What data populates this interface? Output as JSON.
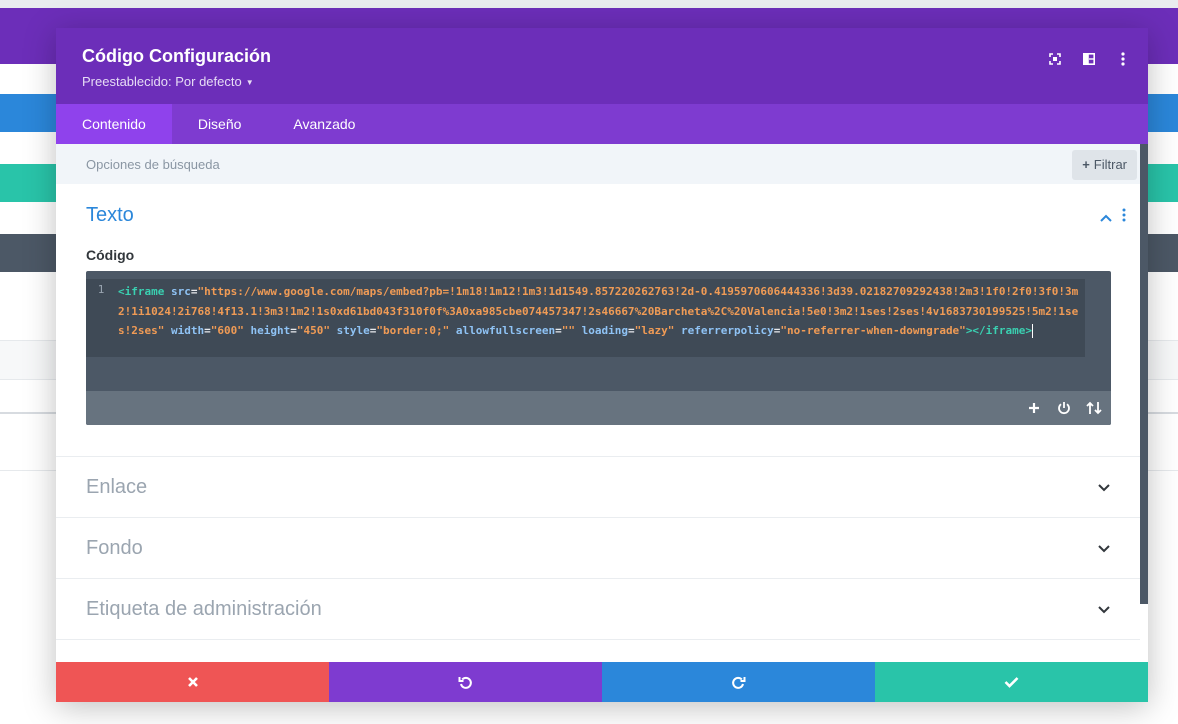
{
  "header": {
    "title": "Código Configuración",
    "preset_label": "Preestablecido: Por defecto"
  },
  "tabs": [
    {
      "label": "Contenido",
      "active": true
    },
    {
      "label": "Diseño",
      "active": false
    },
    {
      "label": "Avanzado",
      "active": false
    }
  ],
  "search": {
    "placeholder": "Opciones de búsqueda",
    "filter_label": "Filtrar"
  },
  "sections": {
    "texto": {
      "title": "Texto",
      "field_label": "Código",
      "editor": {
        "line_number": "1",
        "tokens": {
          "t1": "<iframe",
          "a1": " src",
          "e1": "=",
          "s1": "\"https://www.google.com/maps/embed?pb=!1m18!1m12!1m3!1d1549.857220262763!2d-0.4195970606444336!3d39.02182709292438!2m3!1f0!2f0!3f0!3m2!1i1024!2i768!4f13.1!3m3!1m2!1s0xd61bd043f310f0f%3A0xa985cbe074457347!2s46667%20Barcheta%2C%20Valencia!5e0!3m2!1ses!2ses!4v1683730199525!5m2!1ses!2ses\"",
          "a2": " width",
          "e2": "=",
          "s2": "\"600\"",
          "a3": " height",
          "e3": "=",
          "s3": "\"450\"",
          "a4": " style",
          "e4": "=",
          "s4": "\"border:0;\"",
          "a5": " allowfullscreen",
          "e5": "=",
          "s5": "\"\"",
          "a6": " loading",
          "e6": "=",
          "s6": "\"lazy\"",
          "a7": " referrerpolicy",
          "e7": "=",
          "s7": "\"no-referrer-when-downgrade\"",
          "t2": "></iframe>"
        }
      }
    },
    "enlace": {
      "title": "Enlace"
    },
    "fondo": {
      "title": "Fondo"
    },
    "etiqueta": {
      "title": "Etiqueta de administración"
    }
  },
  "colors": {
    "header": "#6c2eb9",
    "tabs": "#7e3bd0",
    "active_tab": "#8f42ec",
    "accent_blue": "#2b87da",
    "discard": "#ef5555",
    "undo": "#7e3bd0",
    "redo": "#2b87da",
    "save": "#29c4a9"
  },
  "icons": {
    "header": [
      "fullscreen-icon",
      "split-view-icon",
      "more-options-icon"
    ],
    "editor": [
      "plus-icon",
      "power-icon",
      "sort-arrows-icon"
    ],
    "footer": [
      "close-icon",
      "undo-icon",
      "redo-icon",
      "check-icon"
    ]
  }
}
